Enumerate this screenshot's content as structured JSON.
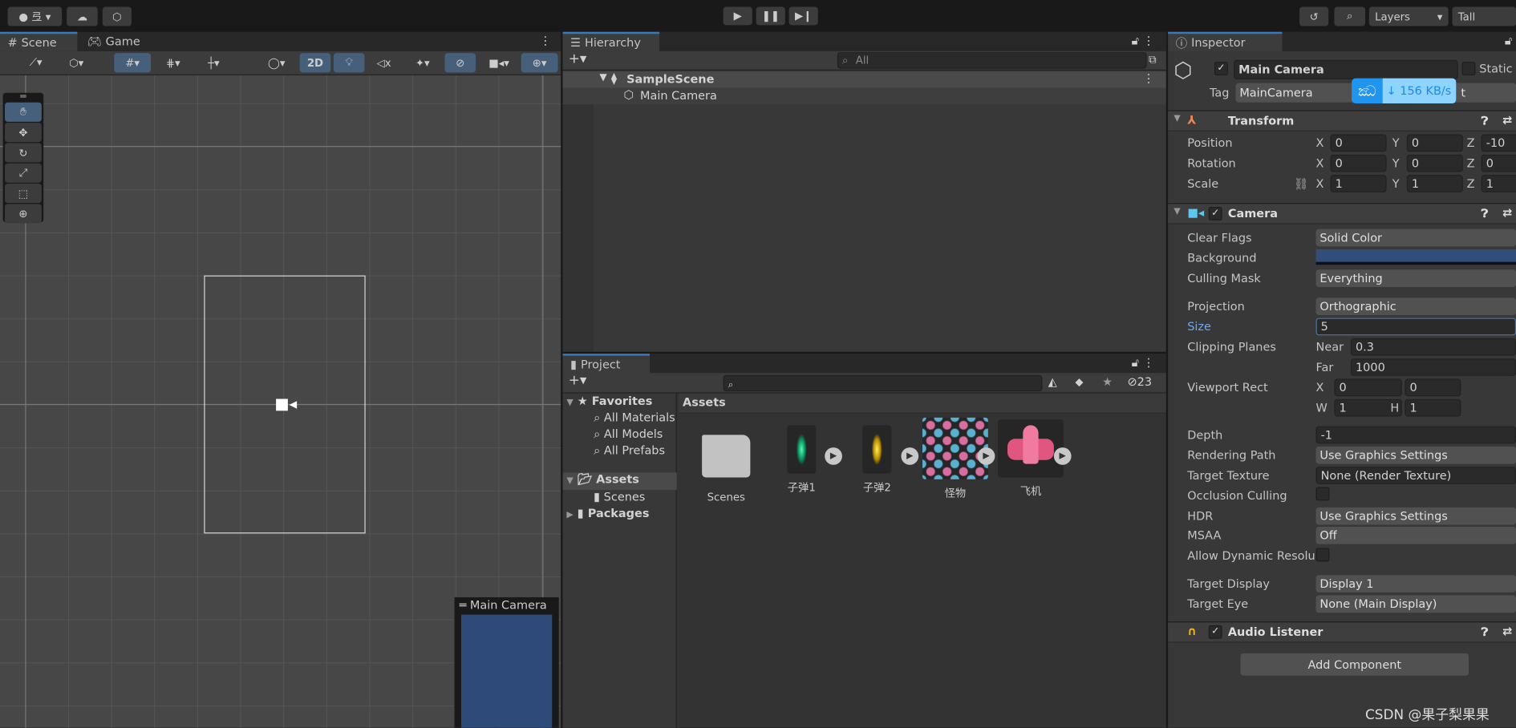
{
  "toolbar": {
    "account_icon": "account-icon",
    "cloud_icon": "cloud-icon",
    "collab_icon": "collab-icon",
    "play_icon": "play-icon",
    "pause_icon": "pause-icon",
    "step_icon": "step-icon",
    "history_icon": "history-icon",
    "search_icon": "search-icon",
    "layers": "Layers",
    "layout": "Tall"
  },
  "scene": {
    "tabs": [
      "Scene",
      "Game"
    ],
    "btn_2d": "2D",
    "camera_preview_title": "Main Camera",
    "camera_bg": "#2e4a78"
  },
  "hierarchy": {
    "tab": "Hierarchy",
    "search_placeholder": "All",
    "scene_name": "SampleScene",
    "items": [
      "Main Camera"
    ]
  },
  "project": {
    "tab": "Project",
    "hidden_count": "23",
    "breadcrumb": "Assets",
    "tree": {
      "favorites": "Favorites",
      "fav_items": [
        "All Materials",
        "All Models",
        "All Prefabs"
      ],
      "assets": "Assets",
      "scenes": "Scenes",
      "packages": "Packages"
    },
    "assets": [
      "Scenes",
      "子弹1",
      "子弹2",
      "怪物",
      "飞机"
    ]
  },
  "inspector": {
    "tab": "Inspector",
    "object_name": "Main Camera",
    "static_label": "Static",
    "tag_label": "Tag",
    "tag_value": "MainCamera",
    "layer_suffix": "t",
    "overlay": {
      "speed": "156 KB/s"
    },
    "transform": {
      "title": "Transform",
      "rows": [
        {
          "label": "Position",
          "x": "0",
          "y": "0",
          "z": "-10"
        },
        {
          "label": "Rotation",
          "x": "0",
          "y": "0",
          "z": "0"
        },
        {
          "label": "Scale",
          "x": "1",
          "y": "1",
          "z": "1"
        }
      ]
    },
    "camera": {
      "title": "Camera",
      "clear_flags": {
        "label": "Clear Flags",
        "value": "Solid Color"
      },
      "background": {
        "label": "Background",
        "color": "#314d79"
      },
      "culling_mask": {
        "label": "Culling Mask",
        "value": "Everything"
      },
      "projection": {
        "label": "Projection",
        "value": "Orthographic"
      },
      "size": {
        "label": "Size",
        "value": "5"
      },
      "clipping": {
        "label": "Clipping Planes",
        "near_label": "Near",
        "near": "0.3",
        "far_label": "Far",
        "far": "1000"
      },
      "viewport": {
        "label": "Viewport Rect",
        "x": "0",
        "y": "0",
        "w": "1",
        "h": "1"
      },
      "depth": {
        "label": "Depth",
        "value": "-1"
      },
      "rendering_path": {
        "label": "Rendering Path",
        "value": "Use Graphics Settings"
      },
      "target_texture": {
        "label": "Target Texture",
        "value": "None (Render Texture)"
      },
      "occlusion": {
        "label": "Occlusion Culling"
      },
      "hdr": {
        "label": "HDR",
        "value": "Use Graphics Settings"
      },
      "msaa": {
        "label": "MSAA",
        "value": "Off"
      },
      "dynamic_res": {
        "label": "Allow Dynamic Resolu"
      },
      "target_display": {
        "label": "Target Display",
        "value": "Display 1"
      },
      "target_eye": {
        "label": "Target Eye",
        "value": "None (Main Display)"
      }
    },
    "audio": {
      "title": "Audio Listener"
    },
    "add_component": "Add Component"
  },
  "watermark": "CSDN @果子梨果果"
}
